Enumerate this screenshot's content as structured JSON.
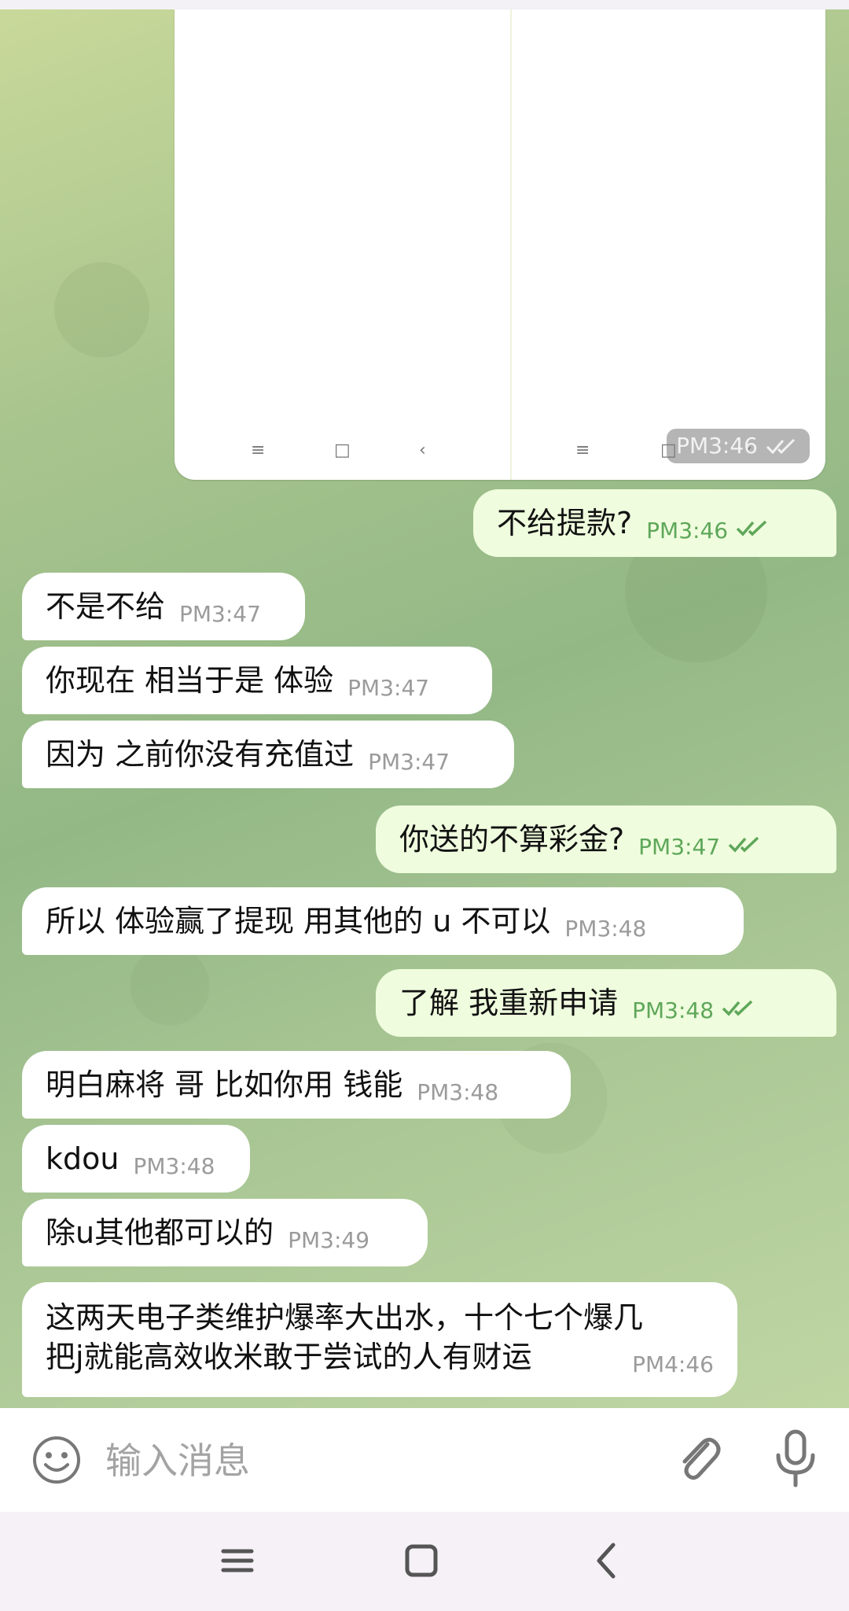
{
  "media": {
    "time": "PM3:46",
    "nav_glyphs": [
      "≡",
      "□",
      "‹",
      "≡",
      "□",
      "‹"
    ]
  },
  "messages": [
    {
      "dir": "out",
      "text": "不给提款?",
      "time": "PM3:46"
    },
    {
      "dir": "in",
      "text": "不是不给",
      "time": "PM3:47"
    },
    {
      "dir": "in",
      "text": "你现在 相当于是 体验",
      "time": "PM3:47"
    },
    {
      "dir": "in",
      "text": "因为 之前你没有充值过",
      "time": "PM3:47"
    },
    {
      "dir": "out",
      "text": "你送的不算彩金?",
      "time": "PM3:47"
    },
    {
      "dir": "in",
      "text": "所以 体验赢了提现 用其他的 u  不可以",
      "time": "PM3:48"
    },
    {
      "dir": "out",
      "text": "了解   我重新申请",
      "time": "PM3:48"
    },
    {
      "dir": "in",
      "text": "明白麻将 哥 比如你用 钱能",
      "time": "PM3:48"
    },
    {
      "dir": "in",
      "text": "kdou",
      "time": "PM3:48"
    },
    {
      "dir": "in",
      "text": "除u其他都可以的",
      "time": "PM3:49"
    },
    {
      "dir": "in",
      "text": "这两天电子类维护爆率大出水，十个七个爆几",
      "text2": "把j就能高效收米敢于尝试的人有财运",
      "time": "PM4:46"
    }
  ],
  "composer": {
    "placeholder": "输入消息"
  },
  "icons": {
    "emoji": "smiley-icon",
    "attach": "paperclip-icon",
    "mic": "microphone-icon",
    "nav_recent": "menu-icon",
    "nav_home": "square-icon",
    "nav_back": "back-chevron-icon"
  },
  "colors": {
    "incoming_bubble": "#ffffff",
    "outgoing_bubble": "#effdde",
    "outgoing_time": "#5fa75a",
    "incoming_time": "#9b9b9b"
  }
}
